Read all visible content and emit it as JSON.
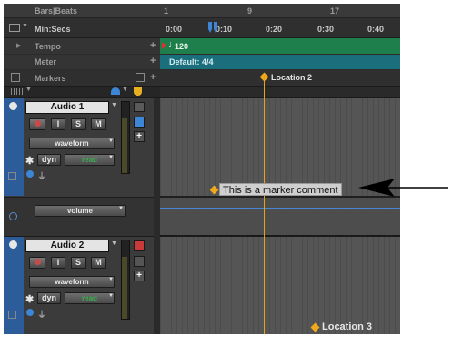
{
  "rulers": {
    "bars_beats": {
      "label": "Bars|Beats",
      "ticks": [
        "1",
        "9",
        "17"
      ]
    },
    "min_secs": {
      "label": "Min:Secs",
      "ticks": [
        "0:00",
        "0:10",
        "0:20",
        "0:30",
        "0:40"
      ]
    },
    "tempo": {
      "label": "Tempo",
      "value": "120"
    },
    "meter": {
      "label": "Meter",
      "value": "Default: 4/4"
    },
    "markers": {
      "label": "Markers"
    }
  },
  "markers": [
    {
      "name": "Location 2"
    },
    {
      "name": "This is a marker comment"
    },
    {
      "name": "Location 3"
    }
  ],
  "tracks": [
    {
      "name": "Audio 1",
      "rec": "●",
      "input": "I",
      "solo": "S",
      "mute": "M",
      "view": "waveform",
      "dyn": "dyn",
      "auto_mode": "read",
      "auto_lane": "volume"
    },
    {
      "name": "Audio 2",
      "rec": "●",
      "input": "I",
      "solo": "S",
      "mute": "M",
      "view": "waveform",
      "dyn": "dyn",
      "auto_mode": "read"
    }
  ],
  "colors": {
    "tempo": "#1e7f4c",
    "meter": "#1b6f7d",
    "track_accent": "#2c5c9a",
    "playhead": "#e8a21a",
    "marker": "#f2a81d",
    "automation": "#4a86d8"
  }
}
